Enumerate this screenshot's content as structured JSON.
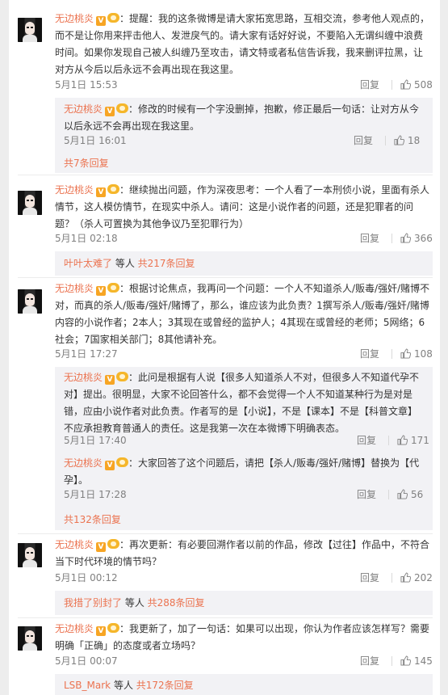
{
  "reply_label": "回复",
  "comments": [
    {
      "author": "无边桃炎",
      "vip_badge": "V",
      "text": "：提醒：我的这条微博是请大家拓宽思路，互相交流，参考他人观点的，而不是让你用来抨击他人、发泄戾气的。请大家有话好好说，不要陷入无谓纠缠中浪费时间。如果你发现自己被人纠缠乃至攻击，请文特或者私信告诉我，我来删评拉黑，让对方从今后以后永远不会再出现在我这里。",
      "time": "5月1日 15:53",
      "likes": "508",
      "replies": [
        {
          "author": "无边桃炎",
          "vip_badge": "V",
          "text": "：修改的时候有一个字没删掉，抱歉，修正最后一句话：让对方从今以后永远不会再出现在我这里。",
          "time": "5月1日 16:01",
          "likes": "18"
        }
      ],
      "more": {
        "prefix": "",
        "suffix": "共7条回复"
      }
    },
    {
      "author": "无边桃炎",
      "vip_badge": "V",
      "text": "：继续抛出问题，作为深夜思考：一个人看了一本刑侦小说，里面有杀人情节，这人模仿情节，在现实中杀人。请问：这是小说作者的问题，还是犯罪者的问题？（杀人可置换为其他争议乃至犯罪行为）",
      "time": "5月1日 02:18",
      "likes": "366",
      "replies": [],
      "more": {
        "prefix": "叶叶太难了",
        "middle": " 等人 ",
        "suffix": "共217条回复"
      }
    },
    {
      "author": "无边桃炎",
      "vip_badge": "V",
      "text": "：根据讨论焦点，我再问一个问题：一个人不知道杀人/贩毒/强奸/赌博不对，而真的杀人/贩毒/强奸/赌博了，那么，谁应该为此负责？1撰写杀人/贩毒/强奸/赌博内容的小说作者；2本人；3其现在或曾经的监护人；4其现在或曾经的老师；5网络；6社会；7国家相关部门；8其他请补充。",
      "time": "5月1日 17:27",
      "likes": "108",
      "replies": [
        {
          "author": "无边桃炎",
          "vip_badge": "V",
          "text": "：此问是根据有人说【很多人知道杀人不对，但很多人不知道代孕不对】提出。很明显，大家不论回答什么，都不会觉得一个人不知道某种行为是对是错，应由小说作者对此负责。作者写的是【小说】，不是【课本】不是【科普文章】不应承担教育普通人的责任。这是我第一次在本微博下明确表态。",
          "time": "5月1日 17:40",
          "likes": "171"
        },
        {
          "author": "无边桃炎",
          "vip_badge": "V",
          "text": "：大家回答了这个问题后，请把【杀人/贩毒/强奸/赌博】替换为【代孕】。",
          "time": "5月1日 17:28",
          "likes": "56"
        }
      ],
      "more": {
        "prefix": "",
        "suffix": "共132条回复"
      }
    },
    {
      "author": "无边桃炎",
      "vip_badge": "V",
      "text": "：再次更新：有必要回溯作者以前的作品，修改【过往】作品中，不符合当下时代环境的情节吗？",
      "time": "5月1日 00:12",
      "likes": "202",
      "replies": [],
      "more": {
        "prefix": "我措了别封了",
        "middle": " 等人 ",
        "suffix": "共288条回复"
      }
    },
    {
      "author": "无边桃炎",
      "vip_badge": "V",
      "text": "：我更新了，加了一句话：如果可以出现，你认为作者应该怎样写？需要明确「正确」的态度或者立场吗？",
      "time": "5月1日 00:07",
      "likes": "145",
      "replies": [],
      "more": {
        "prefix": "LSB_Mark",
        "middle": " 等人 ",
        "suffix": "共172条回复"
      }
    }
  ]
}
